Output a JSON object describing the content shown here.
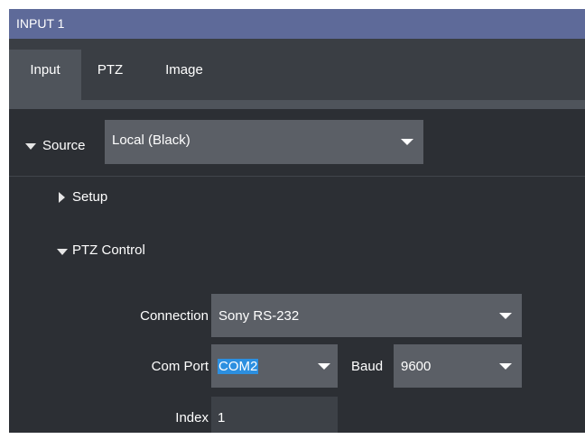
{
  "window": {
    "title": "INPUT 1"
  },
  "tabs": [
    {
      "label": "Input",
      "active": true
    },
    {
      "label": "PTZ",
      "active": false
    },
    {
      "label": "Image",
      "active": false
    }
  ],
  "source": {
    "label": "Source",
    "value": "Local (Black)",
    "expanded": true
  },
  "setup": {
    "label": "Setup",
    "expanded": false
  },
  "ptz_control": {
    "label": "PTZ Control",
    "expanded": true,
    "connection": {
      "label": "Connection",
      "value": "Sony RS-232"
    },
    "com_port": {
      "label": "Com Port",
      "value": "COM2"
    },
    "baud": {
      "label": "Baud",
      "value": "9600"
    },
    "index": {
      "label": "Index",
      "value": "1"
    }
  },
  "colors": {
    "titlebar": "#5e6a99",
    "background": "#2c2f34",
    "dropdown": "#5b5f66",
    "selection": "#2c8fe0"
  }
}
